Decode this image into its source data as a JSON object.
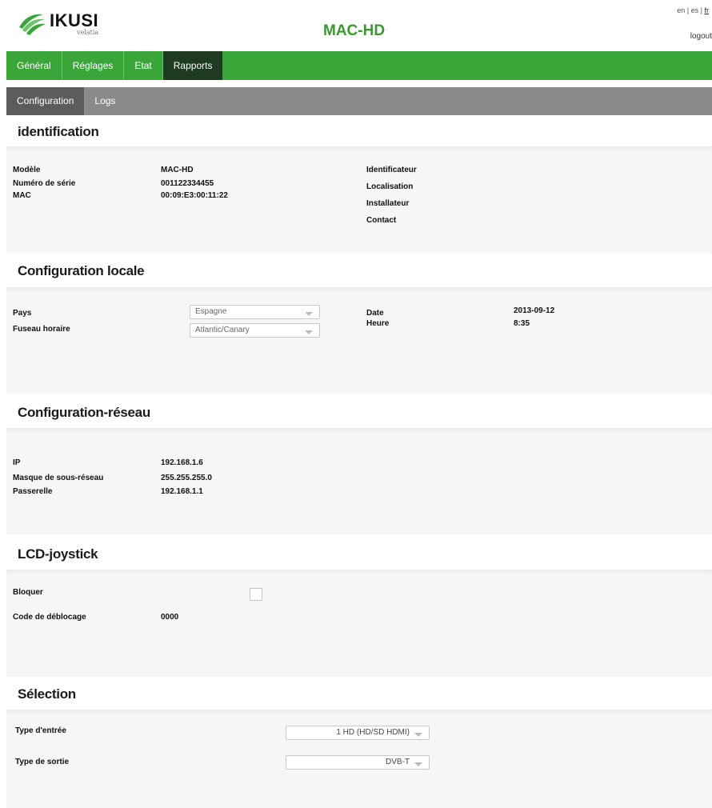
{
  "header": {
    "logo_name": "IKUSI",
    "logo_sub": "velatia",
    "app_title": "MAC-HD",
    "languages": [
      "en",
      "es",
      "fr"
    ],
    "selected_language": "fr",
    "logout_label": "logout"
  },
  "mainnav": {
    "items": [
      {
        "label": "Général"
      },
      {
        "label": "Réglages"
      },
      {
        "label": "Etat"
      },
      {
        "label": "Rapports"
      }
    ],
    "active": "Rapports"
  },
  "subnav": {
    "items": [
      {
        "label": "Configuration"
      },
      {
        "label": "Logs"
      }
    ],
    "active": "Configuration"
  },
  "identification": {
    "title": "identification",
    "model_label": "Modèle",
    "model_value": "MAC-HD",
    "serial_label": "Numéro de série",
    "serial_value": "001122334455",
    "mac_label": "MAC",
    "mac_value": "00:09:E3:00:11:22",
    "identifier_label": "Identificateur",
    "location_label": "Localisation",
    "installer_label": "Installateur",
    "contact_label": "Contact"
  },
  "locale": {
    "title": "Configuration locale",
    "country_label": "Pays",
    "country_value": "Espagne",
    "timezone_label": "Fuseau horaire",
    "timezone_value": "Atlantic/Canary",
    "date_label": "Date",
    "date_value": "2013-09-12",
    "time_label": "Heure",
    "time_value": "8:35"
  },
  "network": {
    "title": "Configuration-réseau",
    "ip_label": "IP",
    "ip_value": "192.168.1.6",
    "mask_label": "Masque de sous-réseau",
    "mask_value": "255.255.255.0",
    "gateway_label": "Passerelle",
    "gateway_value": "192.168.1.1"
  },
  "lcd": {
    "title": "LCD-joystick",
    "lock_label": "Bloquer",
    "lock_checked": false,
    "unlock_code_label": "Code de déblocage",
    "unlock_code_value": "0000"
  },
  "selection": {
    "title": "Sélection",
    "input_type_label": "Type d'entrée",
    "input_type_value": "1 HD (HD/SD HDMI)",
    "output_type_label": "Type de sortie",
    "output_type_value": "DVB-T"
  },
  "colors": {
    "brand_green": "#3aa639",
    "active_tab": "#1e3b22",
    "title_green": "#3a9a2e",
    "subnav_gray": "#8a8a8a"
  }
}
